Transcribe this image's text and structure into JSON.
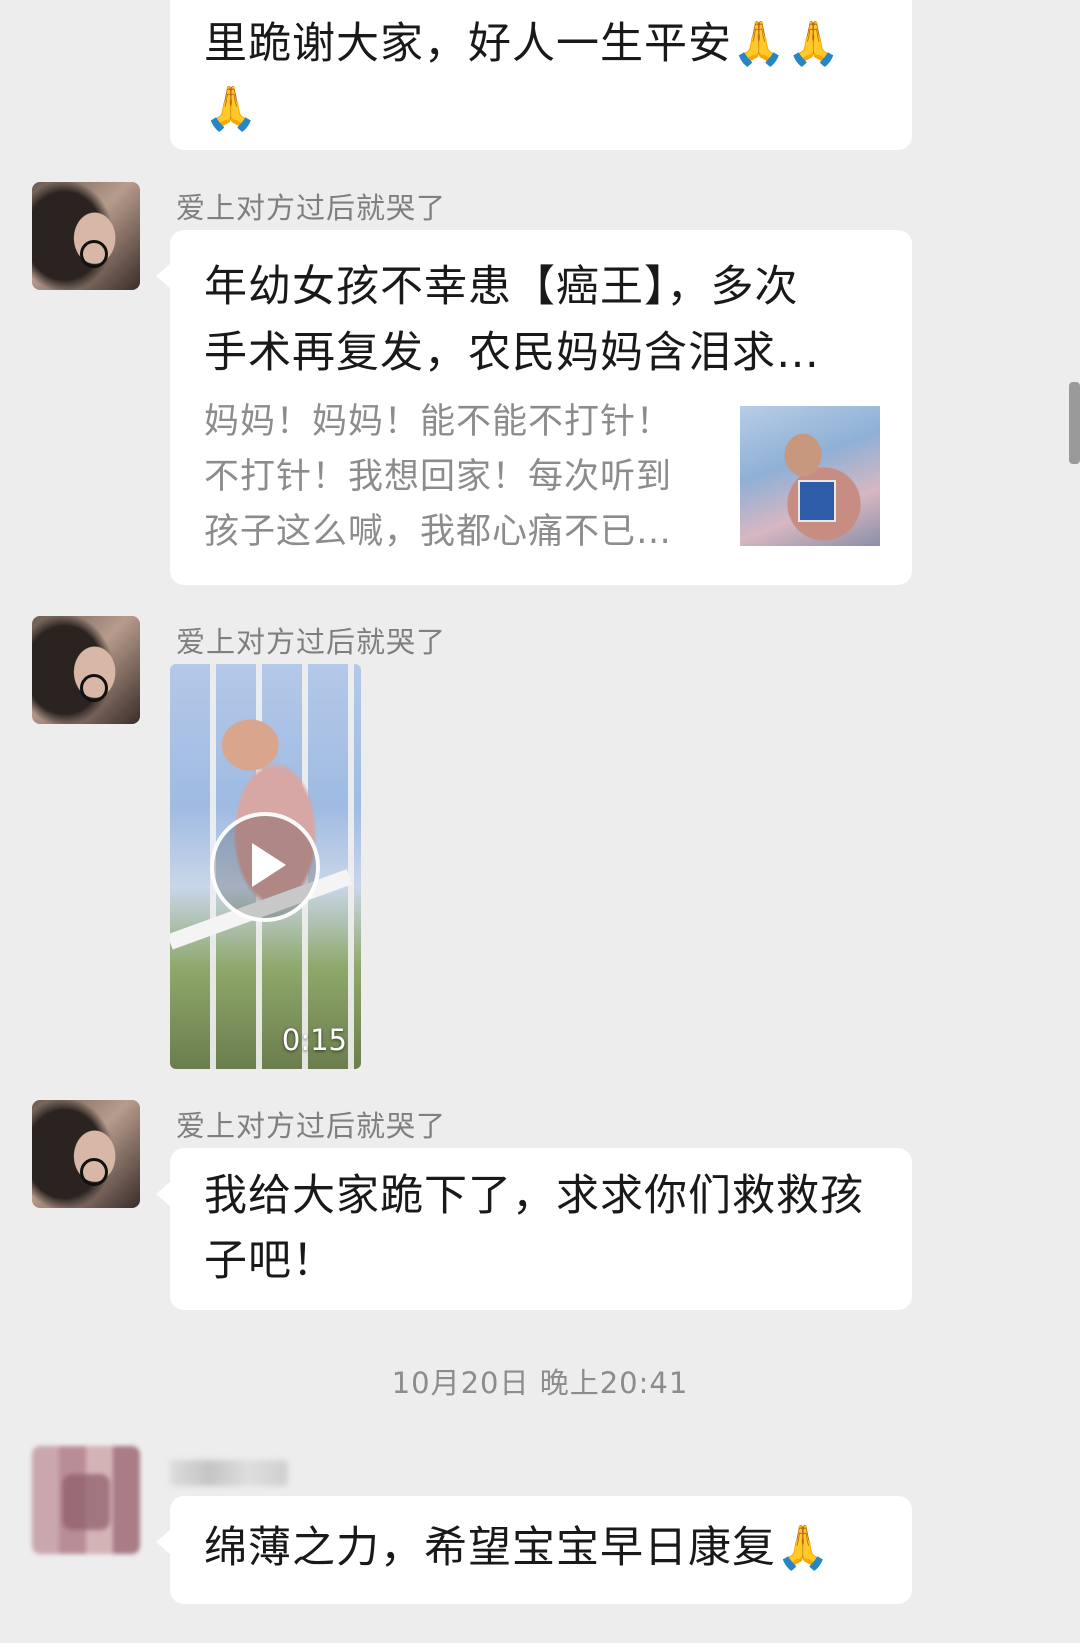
{
  "messages": {
    "m0": {
      "lines": [
        "里跪谢大家，好人一生平安🙏🙏",
        "🙏"
      ]
    },
    "m1": {
      "sender": "爱上对方过后就哭了",
      "card_title_lines": [
        "年幼女孩不幸患【癌王】，多次",
        "手术再复发，农民妈妈含泪求…"
      ],
      "card_desc_lines": [
        "妈妈！妈妈！能不能不打针！",
        "不打针！我想回家！每次听到",
        "孩子这么喊，我都心痛不已…"
      ]
    },
    "m2": {
      "sender": "爱上对方过后就哭了",
      "video_duration": "0:15"
    },
    "m3": {
      "sender": "爱上对方过后就哭了",
      "lines": [
        "我给大家跪下了，求求你们救救孩",
        "子吧！"
      ]
    },
    "timestamp": "10月20日 晚上20:41",
    "m4": {
      "lines": [
        "绵薄之力，希望宝宝早日康复🙏"
      ]
    }
  },
  "colors": {
    "background": "#ededed",
    "bubble": "#ffffff",
    "sender": "#7f7f7f",
    "timestamp": "#8c8c8c"
  }
}
